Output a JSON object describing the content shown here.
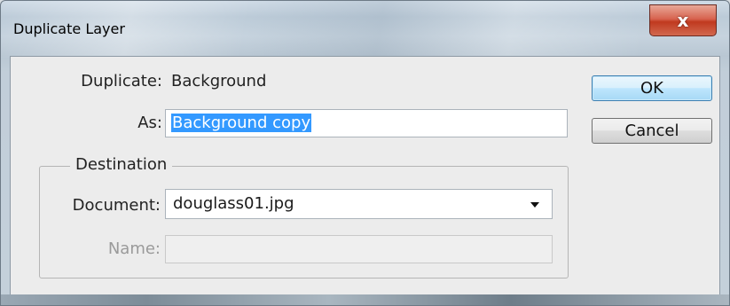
{
  "window": {
    "title": "Duplicate Layer",
    "close_icon": "close-icon",
    "close_glyph": "x"
  },
  "form": {
    "duplicate_label": "Duplicate:",
    "duplicate_value": "Background",
    "as_label": "As:",
    "as_value": "Background copy"
  },
  "buttons": {
    "ok_label": "OK",
    "cancel_label": "Cancel"
  },
  "destination": {
    "legend": "Destination",
    "document_label": "Document:",
    "document_value": "douglass01.jpg",
    "dropdown_icon": "chevron-down-icon",
    "name_label": "Name:",
    "name_value": ""
  },
  "colors": {
    "selection": "#3399ff",
    "close_button": "#c0391f",
    "default_button_border": "#3c7fb1"
  }
}
